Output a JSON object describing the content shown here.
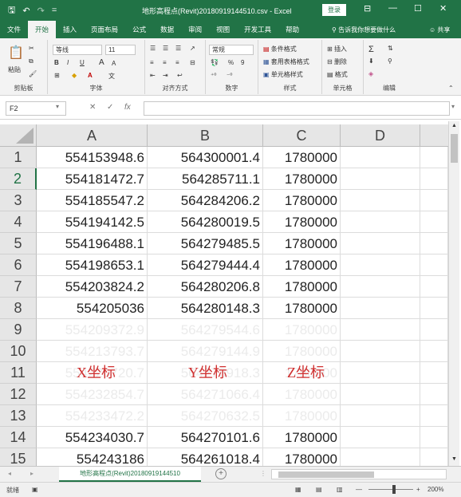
{
  "titlebar": {
    "qat_save": "🖫",
    "qat_undo": "↶",
    "qat_redo": "↷",
    "qat_custom": "=",
    "title": "地形高程点(Revit)20180919144510.csv - Excel",
    "login": "登录",
    "ribbon_display": "⊟",
    "minimize": "—",
    "maximize": "☐",
    "close": "✕"
  },
  "tabs": [
    "文件",
    "开始",
    "插入",
    "页面布局",
    "公式",
    "数据",
    "审阅",
    "视图",
    "开发工具",
    "帮助"
  ],
  "active_tab": "开始",
  "tell_me": "告诉我你想要做什么",
  "share": "共享",
  "ribbon": {
    "clipboard": {
      "label": "剪贴板",
      "paste": "粘贴"
    },
    "font": {
      "label": "字体",
      "name": "等线",
      "size": "11",
      "bold": "B",
      "italic": "I",
      "underline": "U",
      "grow": "A",
      "shrink": "A"
    },
    "alignment": {
      "label": "对齐方式"
    },
    "number": {
      "label": "数字",
      "format": "常规",
      "percent": "%",
      "comma": "9"
    },
    "styles": {
      "label": "样式",
      "conditional": "条件格式",
      "table": "套用表格格式",
      "cell_styles": "单元格样式"
    },
    "cells": {
      "label": "单元格",
      "insert": "插入",
      "delete": "删除",
      "format": "格式"
    },
    "editing": {
      "label": "编辑"
    }
  },
  "formula_bar": {
    "name_box": "F2",
    "cancel": "✕",
    "enter": "✓",
    "fx": "fx",
    "value": ""
  },
  "columns": [
    "A",
    "B",
    "C",
    "D"
  ],
  "rows": [
    {
      "num": "1",
      "a": "554153948.6",
      "b": "564300001.4",
      "c": "1780000",
      "ghost": false
    },
    {
      "num": "2",
      "a": "554181472.7",
      "b": "564285711.1",
      "c": "1780000",
      "ghost": false
    },
    {
      "num": "3",
      "a": "554185547.2",
      "b": "564284206.2",
      "c": "1780000",
      "ghost": false
    },
    {
      "num": "4",
      "a": "554194142.5",
      "b": "564280019.5",
      "c": "1780000",
      "ghost": false
    },
    {
      "num": "5",
      "a": "554196488.1",
      "b": "564279485.5",
      "c": "1780000",
      "ghost": false
    },
    {
      "num": "6",
      "a": "554198653.1",
      "b": "564279444.4",
      "c": "1780000",
      "ghost": false
    },
    {
      "num": "7",
      "a": "554203824.2",
      "b": "564280206.8",
      "c": "1780000",
      "ghost": false
    },
    {
      "num": "8",
      "a": "554205036",
      "b": "564280148.3",
      "c": "1780000",
      "ghost": false
    },
    {
      "num": "9",
      "a": "554209372.9",
      "b": "564279544.6",
      "c": "1780000",
      "ghost": true
    },
    {
      "num": "10",
      "a": "554213793.7",
      "b": "564279144.9",
      "c": "1780000",
      "ghost": true
    },
    {
      "num": "11",
      "a": "554220720.7",
      "b": "564278918.3",
      "c": "1780000",
      "ghost": true
    },
    {
      "num": "12",
      "a": "554232854.7",
      "b": "564271066.4",
      "c": "1780000",
      "ghost": true
    },
    {
      "num": "13",
      "a": "554233472.2",
      "b": "564270632.5",
      "c": "1780000",
      "ghost": true
    },
    {
      "num": "14",
      "a": "554234030.7",
      "b": "564270101.6",
      "c": "1780000",
      "ghost": false
    },
    {
      "num": "15",
      "a": "554243186",
      "b": "564261018.4",
      "c": "1780000",
      "ghost": false
    }
  ],
  "annotations": {
    "x": "X坐标",
    "y": "Y坐标",
    "z": "Z坐标"
  },
  "sheet_tab": "地形高程点(Revit)20180919144510",
  "add_sheet": "+",
  "status": {
    "mode": "就绪",
    "zoom": "200%",
    "zoom_minus": "—",
    "zoom_plus": "+"
  },
  "colors": {
    "accent": "#217346",
    "annotation": "#d03030"
  }
}
